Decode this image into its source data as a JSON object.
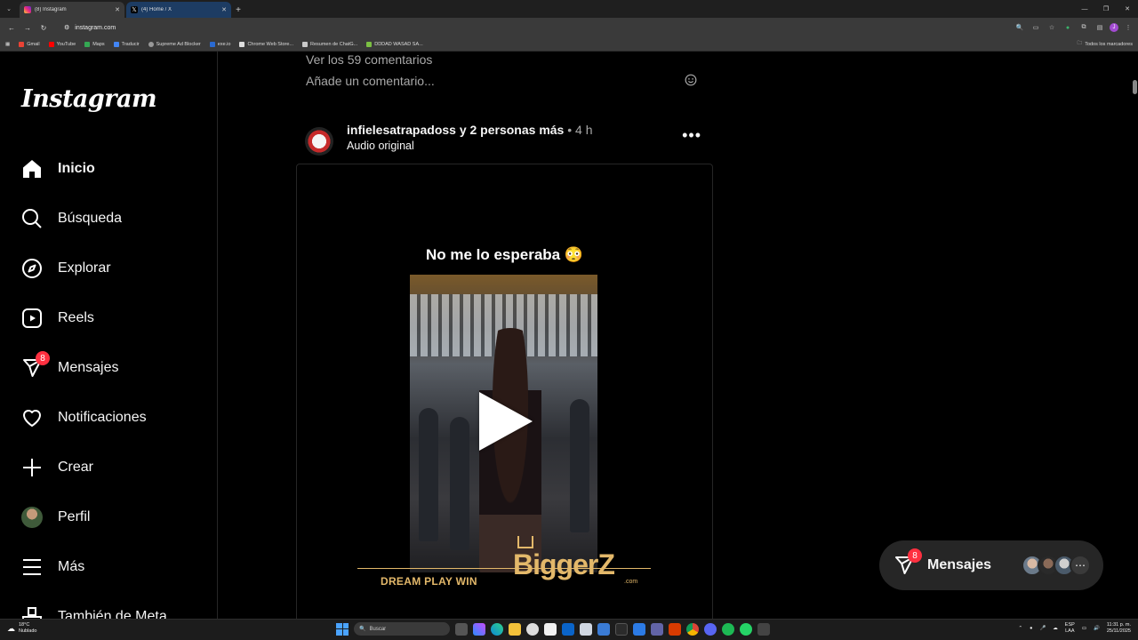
{
  "browser": {
    "tabs": [
      {
        "title": "(8) Instagram",
        "active": true
      },
      {
        "title": "(4) Home / X",
        "active": false
      }
    ],
    "url": "instagram.com",
    "bookmarks": [
      "Gmail",
      "YouTube",
      "Maps",
      "Traducir",
      "Supreme Ad Blocker",
      "exe.io",
      "Chrome Web Store...",
      "Resumen de ChatG...",
      "DDDAD WASAD SA..."
    ],
    "all_bookmarks": "Todos los marcadores",
    "profile_initial": "J"
  },
  "sidebar": {
    "logo": "Instagram",
    "items": [
      {
        "label": "Inicio",
        "icon": "home-icon"
      },
      {
        "label": "Búsqueda",
        "icon": "search-icon"
      },
      {
        "label": "Explorar",
        "icon": "compass-icon"
      },
      {
        "label": "Reels",
        "icon": "reels-icon"
      },
      {
        "label": "Mensajes",
        "icon": "messenger-icon",
        "badge": "8"
      },
      {
        "label": "Notificaciones",
        "icon": "heart-icon"
      },
      {
        "label": "Crear",
        "icon": "plus-icon"
      },
      {
        "label": "Perfil",
        "icon": "avatar"
      },
      {
        "label": "Más",
        "icon": "menu-icon"
      },
      {
        "label": "También de Meta",
        "icon": "meta-icon"
      }
    ]
  },
  "previous_post": {
    "comments_link": "Ver los 59 comentarios",
    "add_comment_placeholder": "Añade un comentario..."
  },
  "post": {
    "author": "infielesatrapadoss",
    "collaborators": "y 2 personas más",
    "time": "4 h",
    "audio": "Audio original",
    "overlay_text": "No me lo esperaba 😳",
    "promo_tagline": "DREAM PLAY WIN",
    "promo_brand": "BiggerZ",
    "promo_domain": ".com"
  },
  "messages_pill": {
    "label": "Mensajes",
    "badge": "8"
  },
  "taskbar": {
    "weather_temp": "18°C",
    "weather_desc": "Nublado",
    "search_placeholder": "Buscar",
    "lang_top": "ESP",
    "lang_bottom": "LAA",
    "time": "11:31 p. m.",
    "date": "25/11/2025"
  }
}
